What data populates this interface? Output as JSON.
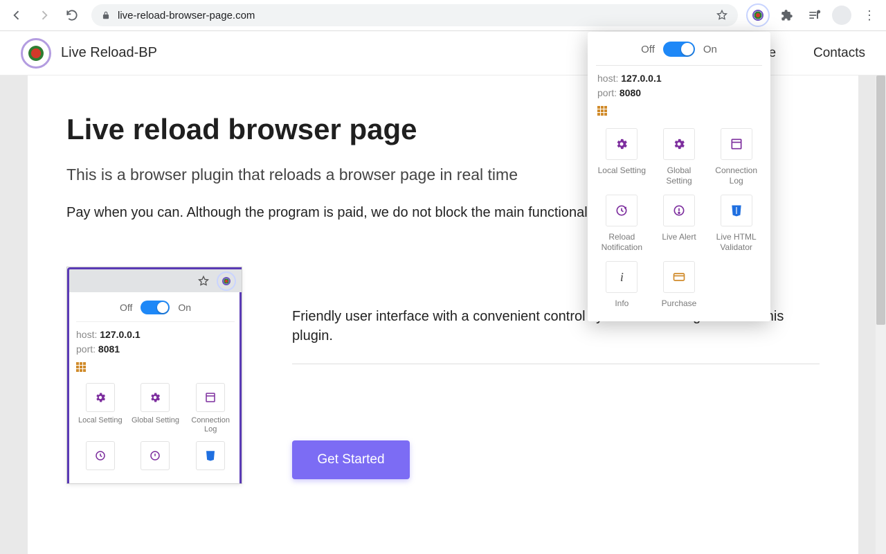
{
  "chrome": {
    "url_host": "live-reload-browser-page.com",
    "url_prefix": ""
  },
  "header": {
    "brand": "Live Reload-BP",
    "nav": {
      "home": "Home",
      "contacts": "Contacts"
    }
  },
  "main": {
    "title": "Live reload browser page",
    "subtitle": "This is a browser plugin that reloads a browser page in real time",
    "body": "Pay when you can. Although the program is paid, we do not block the main functionality                      ed a license.",
    "feature_desc": "Friendly user interface with a convenient control system and configuration of this plugin.",
    "cta": "Get Started"
  },
  "popup": {
    "off": "Off",
    "on": "On",
    "host_label": "host:",
    "host": "127.0.0.1",
    "port_label": "port:",
    "port": "8080",
    "tiles": {
      "local": "Local Setting",
      "global": "Global Setting",
      "connlog": "Connection Log",
      "reloadnotif": "Reload Notification",
      "livealert": "Live Alert",
      "htmlval": "Live HTML Validator",
      "info": "Info",
      "purchase": "Purchase"
    }
  },
  "mini": {
    "off": "Off",
    "on": "On",
    "host_label": "host:",
    "host": "127.0.0.1",
    "port_label": "port:",
    "port": "8081",
    "tiles": {
      "local": "Local Setting",
      "global": "Global Setting",
      "connlog": "Connection Log"
    }
  }
}
